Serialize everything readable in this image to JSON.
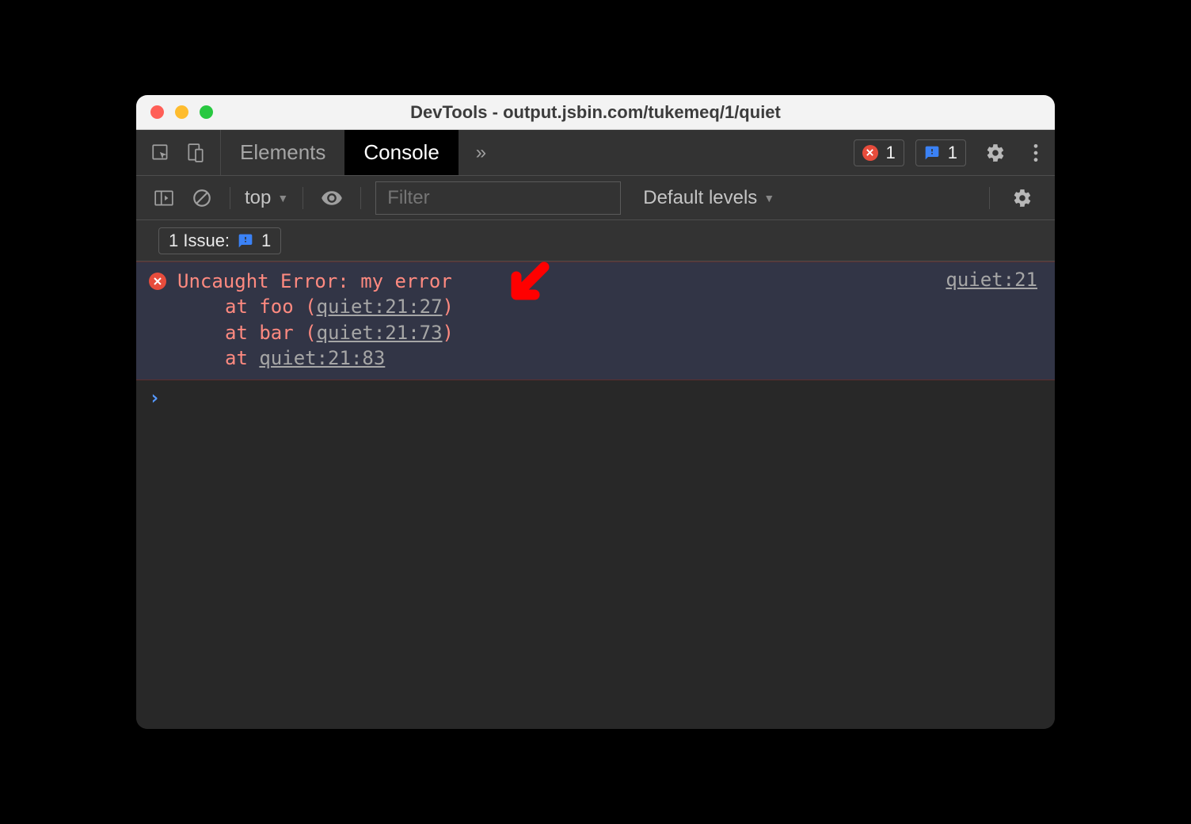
{
  "window": {
    "title": "DevTools - output.jsbin.com/tukemeq/1/quiet"
  },
  "tabs": {
    "elements": "Elements",
    "console": "Console",
    "overflow": "»"
  },
  "badges": {
    "errors": "1",
    "issues": "1"
  },
  "toolbar": {
    "context": "top",
    "filter_placeholder": "Filter",
    "levels": "Default levels"
  },
  "issues_row": {
    "label": "1 Issue:",
    "count": "1"
  },
  "error": {
    "message": "Uncaught Error: my error",
    "stack1_prefix": "at foo (",
    "stack1_link": "quiet:21:27",
    "stack1_suffix": ")",
    "stack2_prefix": "at bar (",
    "stack2_link": "quiet:21:73",
    "stack2_suffix": ")",
    "stack3_prefix": "at ",
    "stack3_link": "quiet:21:83",
    "source_link": "quiet:21"
  },
  "prompt": "›"
}
